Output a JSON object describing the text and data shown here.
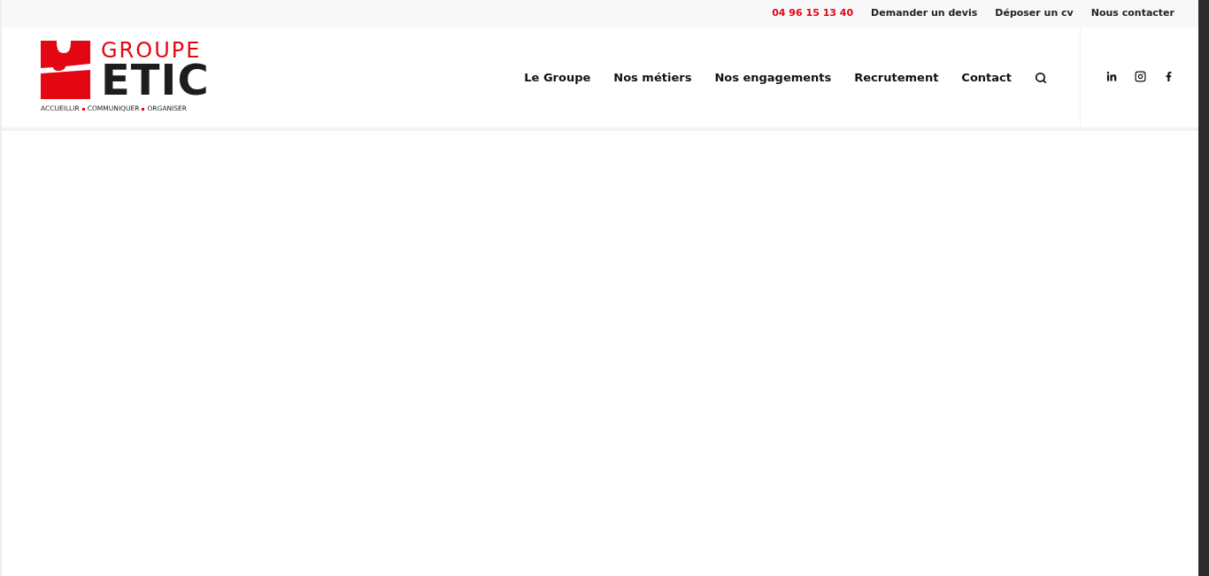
{
  "top_bar": {
    "phone": "04 96 15 13 40",
    "links": [
      "Demander un devis",
      "Déposer un cv",
      "Nous contacter"
    ]
  },
  "logo": {
    "top": "GROUPE",
    "main": "ETIC",
    "tagline": [
      "ACCUEILLIR",
      "COMMUNIQUER",
      "ORGANISER"
    ]
  },
  "nav": {
    "items": [
      "Le Groupe",
      "Nos métiers",
      "Nos engagements",
      "Recrutement",
      "Contact"
    ]
  },
  "social": [
    {
      "kind": "linkedin"
    },
    {
      "kind": "instagram"
    },
    {
      "kind": "facebook"
    }
  ]
}
